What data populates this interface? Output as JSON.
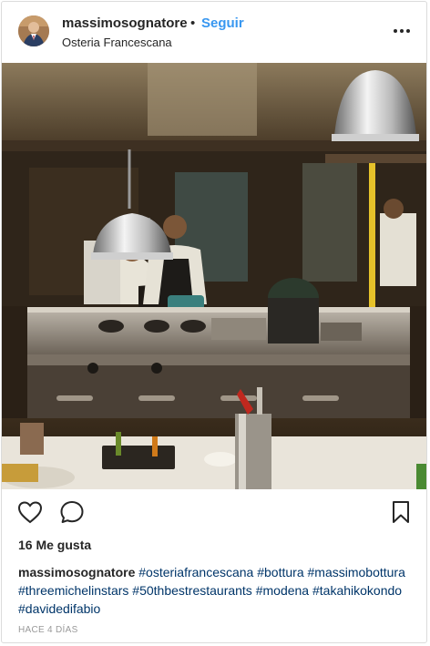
{
  "header": {
    "username": "massimosognatore",
    "separator": "•",
    "follow_label": "Seguir",
    "location": "Osteria Francescana",
    "avatar_icon": "user-avatar",
    "more_icon": "more-dots-icon"
  },
  "photo": {
    "description_icon": "kitchen-photo"
  },
  "actions": {
    "like_icon": "heart-icon",
    "comment_icon": "comment-bubble-icon",
    "save_icon": "bookmark-icon"
  },
  "likes": "16 Me gusta",
  "caption": {
    "username": "massimosognatore",
    "tags": [
      "#osteriafrancescana",
      "#bottura",
      "#massimobottura",
      "#threemichelinstars",
      "#50thbestrestaurants",
      "#modena",
      "#takahikokondo",
      "#davidedifabio"
    ]
  },
  "timestamp": "HACE 4 DÍAS",
  "colors": {
    "link": "#3897f0",
    "hashtag": "#003569",
    "muted": "#999999",
    "border": "#dbdbdb"
  }
}
